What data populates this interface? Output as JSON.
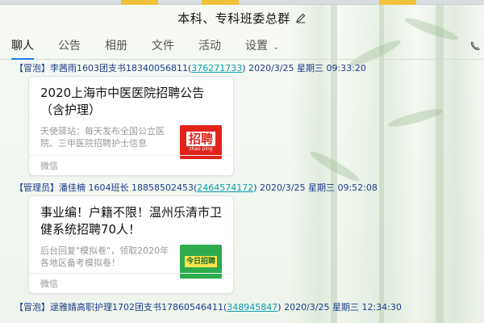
{
  "window": {
    "title": "本科、专科班委总群"
  },
  "tabs": [
    {
      "label": "聊人"
    },
    {
      "label": "公告"
    },
    {
      "label": "相册"
    },
    {
      "label": "文件"
    },
    {
      "label": "活动"
    },
    {
      "label": "设置"
    }
  ],
  "messages": [
    {
      "prefix": "【冒泡】",
      "sender": "李茜雨1603团支书18340056811(",
      "qq": "376271733",
      "close": ")",
      "time": " 2020/3/25 星期三 09:33:20",
      "card": {
        "title": "2020上海市中医医院招聘公告（含护理）",
        "desc": "天使驿站：每天发布全国公立医院、三甲医院招聘护士信息",
        "thumb_text": "招聘",
        "thumb_sub": "zhao  ping",
        "source": "微信"
      }
    },
    {
      "prefix": "【管理员】",
      "sender": "潘佳楠 1604班长 18858502453(",
      "qq": "2464574172",
      "close": ")",
      "time": " 2020/3/25 星期三 09:52:08",
      "card": {
        "title": "事业编！户籍不限！温州乐清市卫健系统招聘70人！",
        "desc": "后台回复\"模拟卷\"，领取2020年各地区备考模拟卷！",
        "thumb_text": "今日招聘",
        "source": "微信"
      }
    },
    {
      "prefix": "【冒泡】",
      "sender": "逯雅婧高职护理1702团支书17860546411(",
      "qq": "348945847",
      "close": ")",
      "time": " 2020/3/25 星期三 12:34:30"
    }
  ],
  "colors": {
    "accent": "#1e7fe0",
    "sender": "#1c3d8c",
    "qq_link": "#0a9db3",
    "thumb1_bg": "#e0241b",
    "thumb2_bg": "#2eab4d"
  }
}
